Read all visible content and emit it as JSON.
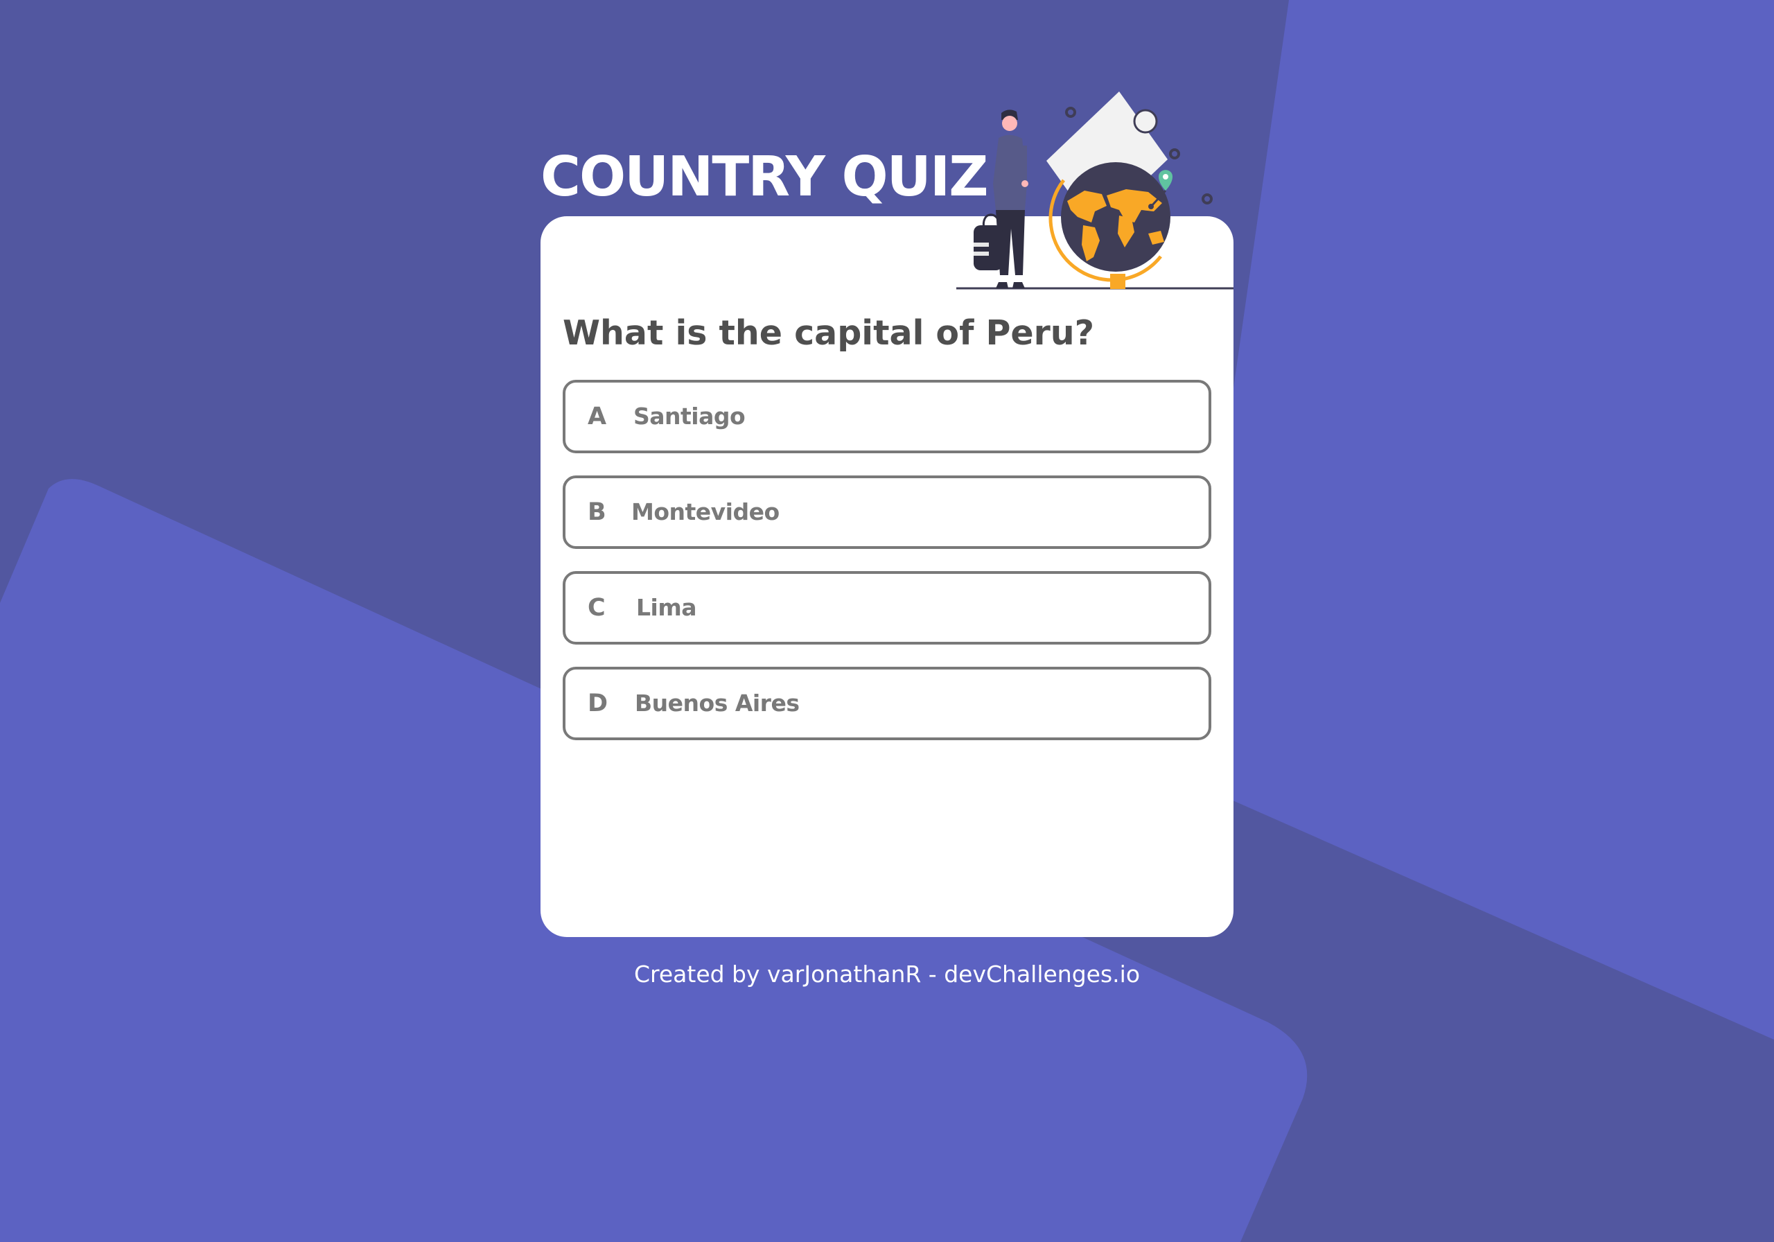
{
  "app": {
    "title": "COUNTRY QUIZ"
  },
  "quiz": {
    "question": "What is the capital of Peru?",
    "options": [
      {
        "letter": "A",
        "text": "Santiago"
      },
      {
        "letter": "B",
        "text": "Montevideo"
      },
      {
        "letter": "C",
        "text": "Lima"
      },
      {
        "letter": "D",
        "text": "Buenos Aires"
      }
    ]
  },
  "footer": {
    "text": "Created by varJonathanR - devChallenges.io"
  },
  "illustration": {
    "icon": "traveler-globe-icon"
  },
  "colors": {
    "background": "#5257a0",
    "background_shape": "#5c62c2",
    "card": "#ffffff",
    "question_text": "#4f4f4f",
    "option_border": "#797979",
    "globe_accent": "#f9a826",
    "globe_body": "#3f3d56",
    "pin": "#60c3a0"
  }
}
